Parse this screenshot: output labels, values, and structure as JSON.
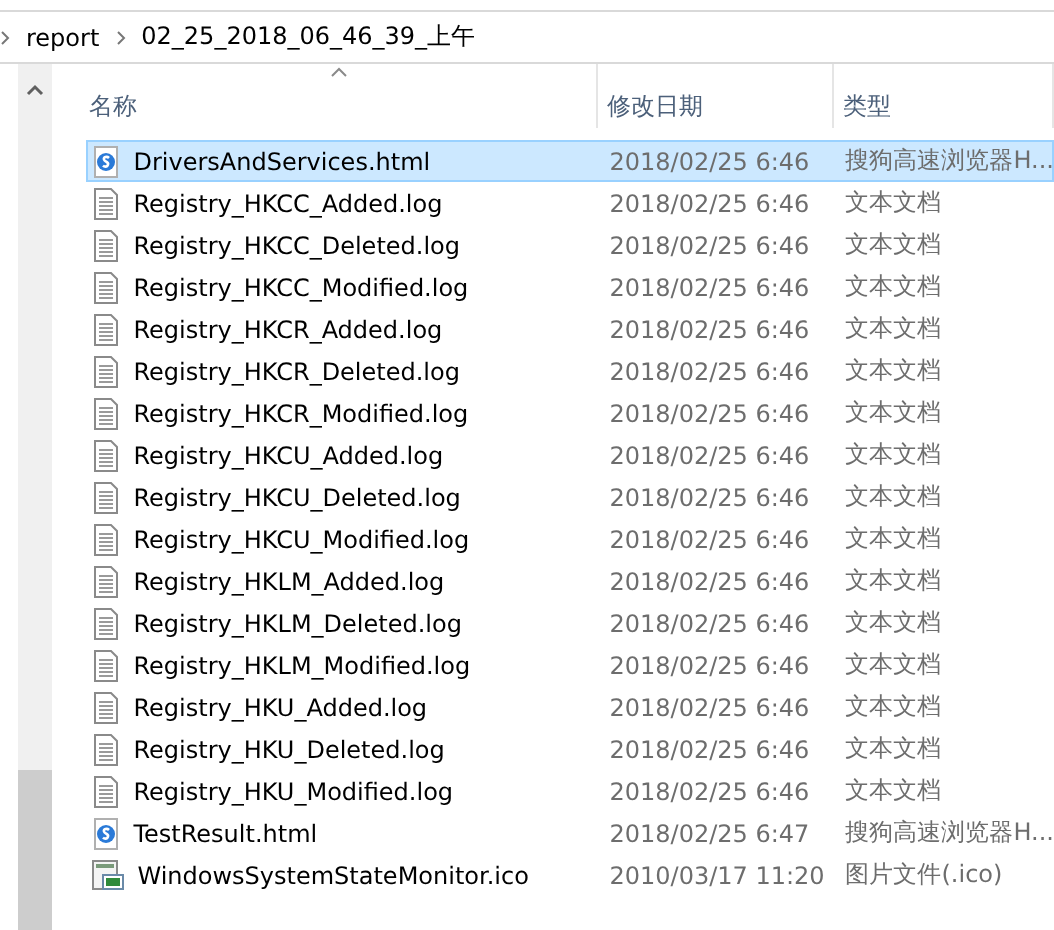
{
  "address_bar": {
    "path": [
      "report",
      "02_25_2018_06_46_39_上午"
    ]
  },
  "columns": [
    {
      "label": "名称",
      "sorted": true
    },
    {
      "label": "修改日期",
      "sorted": false
    },
    {
      "label": "类型",
      "sorted": false
    }
  ],
  "files": [
    {
      "name": "DriversAndServices.html",
      "date": "2018/02/25 6:46",
      "type": "搜狗高速浏览器H...",
      "kind": "html",
      "selected": true
    },
    {
      "name": "Registry_HKCC_Added.log",
      "date": "2018/02/25 6:46",
      "type": "文本文档",
      "kind": "log",
      "selected": false
    },
    {
      "name": "Registry_HKCC_Deleted.log",
      "date": "2018/02/25 6:46",
      "type": "文本文档",
      "kind": "log",
      "selected": false
    },
    {
      "name": "Registry_HKCC_Modified.log",
      "date": "2018/02/25 6:46",
      "type": "文本文档",
      "kind": "log",
      "selected": false
    },
    {
      "name": "Registry_HKCR_Added.log",
      "date": "2018/02/25 6:46",
      "type": "文本文档",
      "kind": "log",
      "selected": false
    },
    {
      "name": "Registry_HKCR_Deleted.log",
      "date": "2018/02/25 6:46",
      "type": "文本文档",
      "kind": "log",
      "selected": false
    },
    {
      "name": "Registry_HKCR_Modified.log",
      "date": "2018/02/25 6:46",
      "type": "文本文档",
      "kind": "log",
      "selected": false
    },
    {
      "name": "Registry_HKCU_Added.log",
      "date": "2018/02/25 6:46",
      "type": "文本文档",
      "kind": "log",
      "selected": false
    },
    {
      "name": "Registry_HKCU_Deleted.log",
      "date": "2018/02/25 6:46",
      "type": "文本文档",
      "kind": "log",
      "selected": false
    },
    {
      "name": "Registry_HKCU_Modified.log",
      "date": "2018/02/25 6:46",
      "type": "文本文档",
      "kind": "log",
      "selected": false
    },
    {
      "name": "Registry_HKLM_Added.log",
      "date": "2018/02/25 6:46",
      "type": "文本文档",
      "kind": "log",
      "selected": false
    },
    {
      "name": "Registry_HKLM_Deleted.log",
      "date": "2018/02/25 6:46",
      "type": "文本文档",
      "kind": "log",
      "selected": false
    },
    {
      "name": "Registry_HKLM_Modified.log",
      "date": "2018/02/25 6:46",
      "type": "文本文档",
      "kind": "log",
      "selected": false
    },
    {
      "name": "Registry_HKU_Added.log",
      "date": "2018/02/25 6:46",
      "type": "文本文档",
      "kind": "log",
      "selected": false
    },
    {
      "name": "Registry_HKU_Deleted.log",
      "date": "2018/02/25 6:46",
      "type": "文本文档",
      "kind": "log",
      "selected": false
    },
    {
      "name": "Registry_HKU_Modified.log",
      "date": "2018/02/25 6:46",
      "type": "文本文档",
      "kind": "log",
      "selected": false
    },
    {
      "name": "TestResult.html",
      "date": "2018/02/25 6:47",
      "type": "搜狗高速浏览器H...",
      "kind": "html",
      "selected": false
    },
    {
      "name": "WindowsSystemStateMonitor.ico",
      "date": "2010/03/17 11:20",
      "type": "图片文件(.ico)",
      "kind": "ico",
      "selected": false
    }
  ]
}
